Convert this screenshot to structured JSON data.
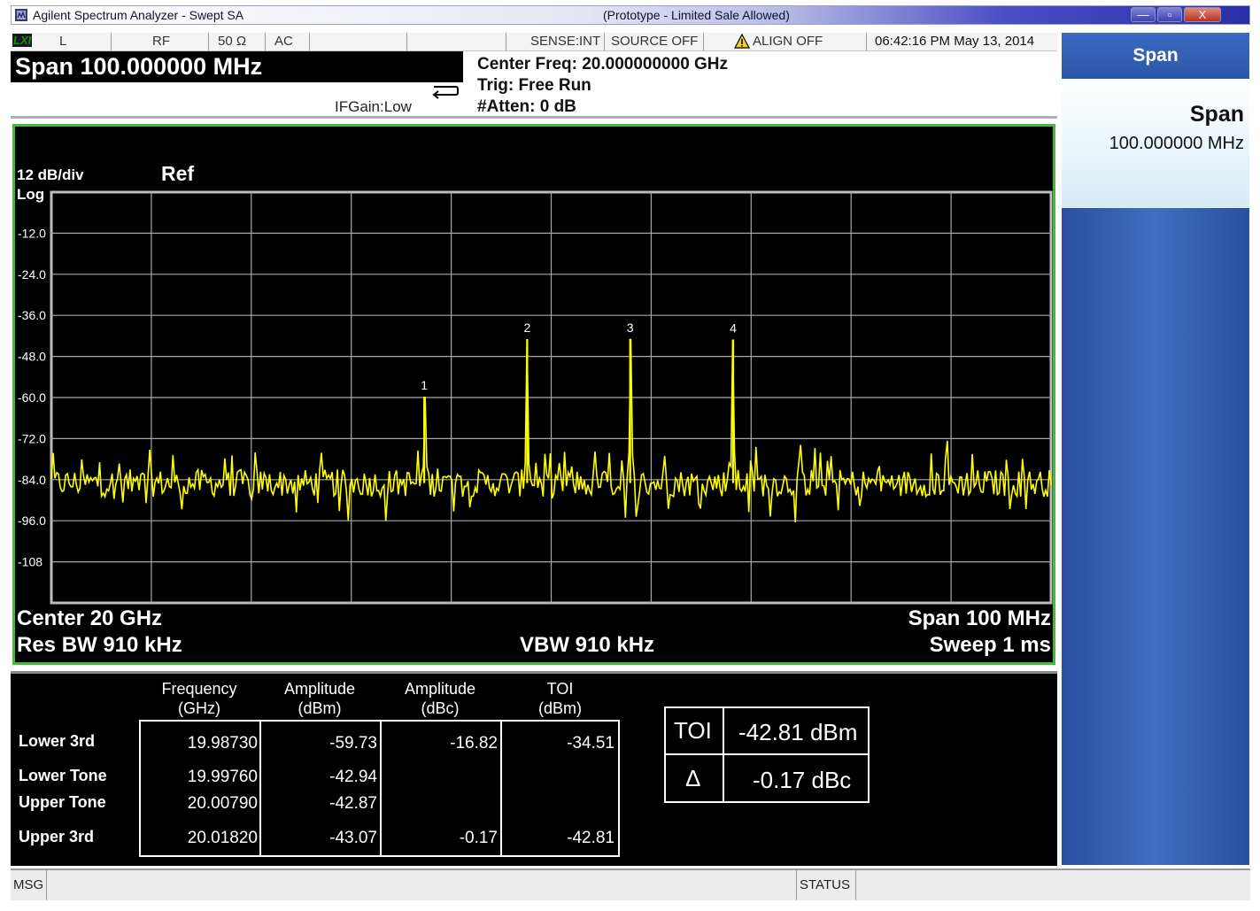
{
  "window": {
    "title": "Agilent Spectrum Analyzer - Swept SA",
    "subtitle": "(Prototype - Limited Sale Allowed)",
    "buttons": {
      "minimize": "—",
      "maximize": "▫",
      "close": "X"
    }
  },
  "status_bar": {
    "lxi": "LXI",
    "l": "L",
    "rf": "RF",
    "impedance": "50 Ω",
    "coupling": "AC",
    "sense": "SENSE:INT",
    "source": "SOURCE OFF",
    "align": "ALIGN OFF",
    "datetime": "06:42:16 PM May 13, 2014"
  },
  "header": {
    "span": "Span 100.000000 MHz",
    "ifgain": "IFGain:Low",
    "center_freq": "Center Freq: 20.000000000 GHz",
    "trig": "Trig: Free Run",
    "atten": "#Atten: 0 dB"
  },
  "softkey_panel": {
    "menu_title": "Span",
    "key_label": "Span",
    "key_value": "100.000000 MHz"
  },
  "plot": {
    "scale": "12 dB/div",
    "scale_type": "Log",
    "ref": "Ref",
    "center": "Center  20 GHz",
    "res_bw": "Res BW  910 kHz",
    "vbw": "VBW  910 kHz",
    "span": "Span 100 MHz",
    "sweep": "Sweep   1 ms"
  },
  "chart_data": {
    "type": "line",
    "y_tick_labels": [
      "-12.0",
      "-24.0",
      "-36.0",
      "-48.0",
      "-60.0",
      "-72.0",
      "-84.0",
      "-96.0",
      "-108"
    ],
    "ylim": [
      -120,
      0
    ],
    "xlim_ghz": [
      19.95,
      20.05
    ],
    "x_divisions": 10,
    "y_divisions": 10,
    "noise_floor_dbm": -85,
    "trace_color": "#ffff00",
    "grid": true,
    "markers": [
      {
        "label": "1",
        "freq_ghz": 19.9873,
        "amp_dbm": -59.73
      },
      {
        "label": "2",
        "freq_ghz": 19.9976,
        "amp_dbm": -42.94
      },
      {
        "label": "3",
        "freq_ghz": 20.0079,
        "amp_dbm": -42.87
      },
      {
        "label": "4",
        "freq_ghz": 20.0182,
        "amp_dbm": -43.07
      }
    ]
  },
  "results": {
    "headers": [
      {
        "line1": "Frequency",
        "line2": "(GHz)"
      },
      {
        "line1": "Amplitude",
        "line2": "(dBm)"
      },
      {
        "line1": "Amplitude",
        "line2": "(dBc)"
      },
      {
        "line1": "TOI",
        "line2": "(dBm)"
      }
    ],
    "rows": [
      {
        "label": "Lower 3rd",
        "freq": "19.98730",
        "amp_dbm": "-59.73",
        "amp_dbc": "-16.82",
        "toi": "-34.51"
      },
      {
        "label": "Lower Tone",
        "freq": "19.99760",
        "amp_dbm": "-42.94",
        "amp_dbc": "",
        "toi": ""
      },
      {
        "label": "Upper Tone",
        "freq": "20.00790",
        "amp_dbm": "-42.87",
        "amp_dbc": "",
        "toi": ""
      },
      {
        "label": "Upper 3rd",
        "freq": "20.01820",
        "amp_dbm": "-43.07",
        "amp_dbc": "-0.17",
        "toi": "-42.81"
      }
    ],
    "summary": {
      "toi_label": "TOI",
      "toi_value": "-42.81 dBm",
      "delta_label": "Δ",
      "delta_value": "-0.17 dBc"
    }
  },
  "message_bar": {
    "msg": "MSG",
    "status": "STATUS"
  }
}
